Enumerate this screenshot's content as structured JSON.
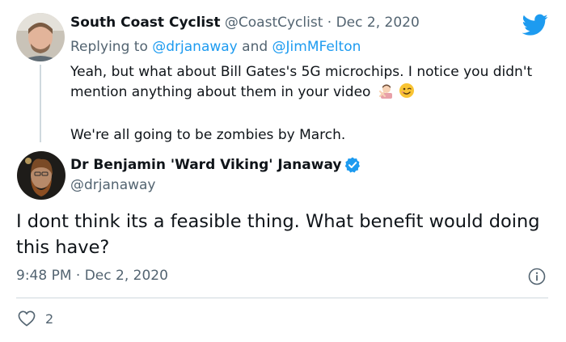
{
  "reply_tweet": {
    "author_name": "South Coast Cyclist",
    "handle": "@CoastCyclist",
    "separator": "·",
    "date": "Dec 2, 2020",
    "replying_label": "Replying to",
    "reply_user_1": "@drjanaway",
    "reply_and": "and",
    "reply_user_2": "@JimMFelton",
    "text_line_1": "Yeah, but what about Bill Gates's 5G microchips. I notice you didn't mention anything about them in your video",
    "emoji_1": "person-gesturing-no",
    "emoji_2": "winking-face",
    "text_line_2": "We're all going to be zombies by March."
  },
  "main_tweet": {
    "author_name": "Dr Benjamin 'Ward Viking' Janaway",
    "verified": true,
    "handle": "@drjanaway",
    "text": "I dont think its a feasible thing. What benefit would doing this have?",
    "time": "9:48 PM",
    "separator": "·",
    "date": "Dec 2, 2020",
    "like_count": "2"
  },
  "colors": {
    "accent": "#1d9bf0",
    "muted": "#536471",
    "divider": "#cfd9de"
  }
}
